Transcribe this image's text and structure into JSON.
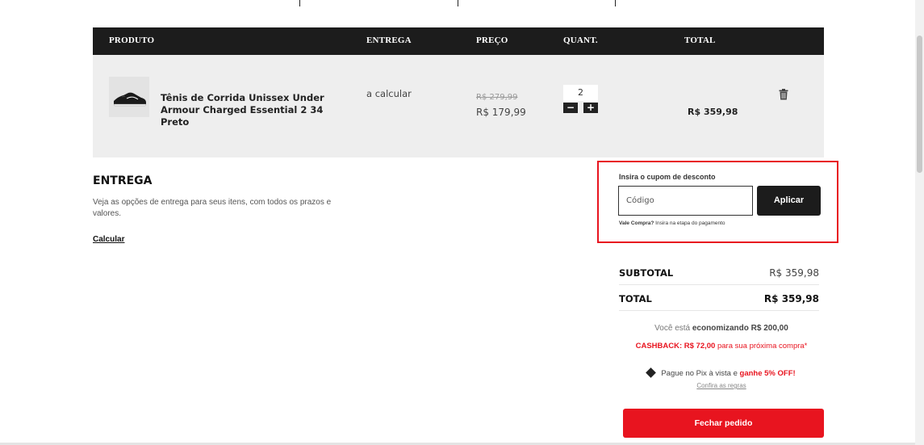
{
  "table": {
    "headers": {
      "product": "PRODUTO",
      "delivery": "ENTREGA",
      "price": "PREÇO",
      "quantity": "QUANT.",
      "total": "TOTAL"
    }
  },
  "item": {
    "name": "Tênis de Corrida Unissex Under Armour Charged Essential 2 34 Preto",
    "delivery": "a calcular",
    "price_old": "R$ 279,99",
    "price_new": "R$ 179,99",
    "quantity": "2",
    "decrease_label": "−",
    "increase_label": "+",
    "total": "R$ 359,98"
  },
  "delivery": {
    "title": "ENTREGA",
    "description": "Veja as opções de entrega para seus itens, com todos os prazos e valores.",
    "calc_link": "Calcular"
  },
  "coupon": {
    "label": "Insira o cupom de desconto",
    "placeholder": "Código",
    "apply_label": "Aplicar",
    "note_bold": "Vale Compra?",
    "note_rest": "Insira na etapa do pagamento"
  },
  "summary": {
    "subtotal_label": "SUBTOTAL",
    "subtotal_value": "R$ 359,98",
    "total_label": "TOTAL",
    "total_value": "R$ 359,98",
    "savings_prefix": "Você está",
    "savings_bold": "economizando R$ 200,00",
    "cashback_bold": "CASHBACK: R$ 72,00",
    "cashback_rest": "para sua próxima compra*",
    "pix_prefix": "Pague no Pix à vista e",
    "pix_bold": "ganhe 5% OFF!",
    "rules_link": "Confira as regras",
    "checkout_label": "Fechar pedido"
  },
  "colors": {
    "accent": "#e8141f",
    "header_bg": "#1c1c1c",
    "row_bg": "#eeeeee"
  },
  "icons": [
    "sneaker-image",
    "trash-icon",
    "pix-icon"
  ]
}
